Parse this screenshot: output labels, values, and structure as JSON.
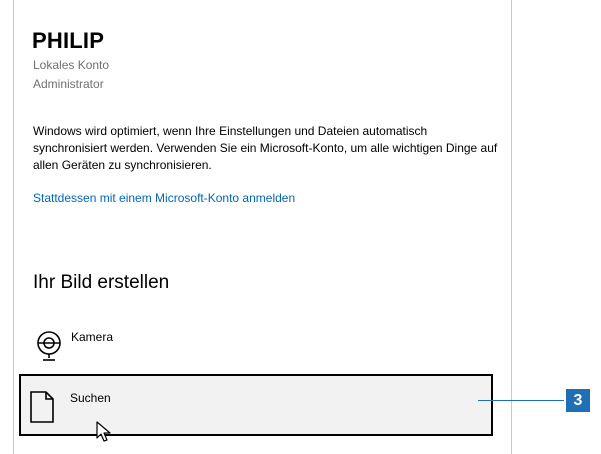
{
  "account": {
    "name": "PHILIP",
    "type": "Lokales Konto",
    "role": "Administrator"
  },
  "description": "Windows wird optimiert, wenn Ihre Einstellungen und Dateien automatisch synchronisiert werden. Verwenden Sie ein Microsoft-Konto, um alle wichtigen Dinge auf allen Geräten zu synchronisieren.",
  "ms_link": "Stattdessen mit einem Microsoft-Konto anmelden",
  "picture_section": {
    "title": "Ihr Bild erstellen",
    "options": [
      {
        "label": "Kamera",
        "icon": "camera-icon"
      },
      {
        "label": "Suchen",
        "icon": "file-icon"
      }
    ]
  },
  "annotation": {
    "badge": "3",
    "color": "#1f6fb5"
  },
  "colors": {
    "link": "#0067b8",
    "highlight_bg": "#f2f2f2"
  }
}
